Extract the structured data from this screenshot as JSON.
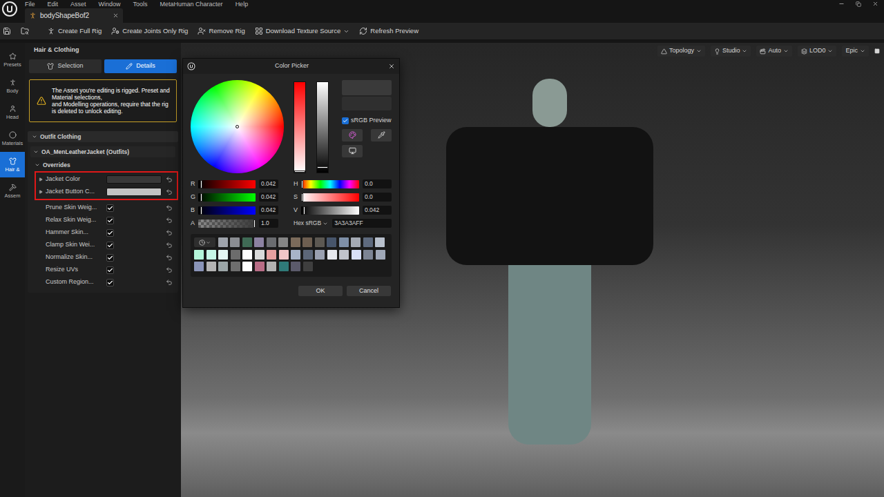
{
  "app": {
    "menu": [
      "File",
      "Edit",
      "Asset",
      "Window",
      "Tools",
      "MetaHuman Character",
      "Help"
    ],
    "document_tab": "bodyShapeBof2"
  },
  "toolbar": [
    {
      "label": "Create Full Rig",
      "dropdown": false
    },
    {
      "label": "Create Joints Only Rig",
      "dropdown": false
    },
    {
      "label": "Remove Rig",
      "dropdown": false
    },
    {
      "label": "Download Texture Source",
      "dropdown": true
    },
    {
      "label": "Refresh Preview",
      "dropdown": false
    }
  ],
  "sidebar": {
    "items": [
      {
        "label": "Presets",
        "selected": false
      },
      {
        "label": "Body",
        "selected": false
      },
      {
        "label": "Head",
        "selected": false
      },
      {
        "label": "Materials",
        "selected": false
      },
      {
        "label": "Hair &",
        "selected": true
      },
      {
        "label": "Assem",
        "selected": false
      }
    ]
  },
  "panel": {
    "title": "Hair & Clothing",
    "tabs": [
      {
        "label": "Selection",
        "selected": false
      },
      {
        "label": "Details",
        "selected": true
      }
    ],
    "warning": "The Asset you're editing is rigged. Preset and Material selections,\nand Modelling operations, require that the rig is deleted to unlock editing.",
    "section": {
      "title": "Outfit Clothing",
      "expanded": true
    },
    "asset": {
      "title": "OA_MenLeatherJacket (Outfits)",
      "expanded": true
    },
    "group": {
      "title": "Overrides",
      "expanded": true
    },
    "properties": [
      {
        "label": "Jacket Color",
        "kind": "color",
        "color": "#383838",
        "highlighted": true
      },
      {
        "label": "Jacket Button C...",
        "kind": "color",
        "color": "#c2c2c2",
        "highlighted": true
      },
      {
        "label": "Prune Skin Weig...",
        "kind": "checkbox",
        "checked": true,
        "highlighted": false
      },
      {
        "label": "Relax Skin Weig...",
        "kind": "checkbox",
        "checked": true,
        "highlighted": false
      },
      {
        "label": "Hammer Skin...",
        "kind": "checkbox",
        "checked": true,
        "highlighted": false
      },
      {
        "label": "Clamp Skin Wei...",
        "kind": "checkbox",
        "checked": true,
        "highlighted": false
      },
      {
        "label": "Normalize Skin...",
        "kind": "checkbox",
        "checked": true,
        "highlighted": false
      },
      {
        "label": "Resize UVs",
        "kind": "checkbox",
        "checked": true,
        "highlighted": false
      },
      {
        "label": "Custom Region...",
        "kind": "checkbox",
        "checked": true,
        "highlighted": false
      }
    ]
  },
  "viewport": {
    "buttons": [
      {
        "label": "Topology"
      },
      {
        "label": "Studio"
      },
      {
        "label": "Auto"
      },
      {
        "label": "LOD0"
      },
      {
        "label": "Epic"
      }
    ]
  },
  "color_picker": {
    "title": "Color Picker",
    "new_color": "#3a3a3a",
    "old_color": "#2f2f2f",
    "saturation_bar": {
      "level": 0.0
    },
    "value_bar": {
      "level": 0.042
    },
    "srgb_preview": {
      "label": "sRGB Preview",
      "checked": true
    },
    "sliders_left": [
      {
        "label": "R",
        "kind": "channel",
        "color": "#ff0000",
        "level": 0.042,
        "value": "0.042"
      },
      {
        "label": "G",
        "kind": "channel",
        "color": "#00ff00",
        "level": 0.042,
        "value": "0.042"
      },
      {
        "label": "B",
        "kind": "channel",
        "color": "#0000ff",
        "level": 0.042,
        "value": "0.042"
      },
      {
        "label": "A",
        "kind": "alpha",
        "level": 1.0,
        "value": "1.0"
      }
    ],
    "sliders_right": [
      {
        "label": "H",
        "kind": "hue",
        "level": 0.0,
        "value": "0.0"
      },
      {
        "label": "S",
        "kind": "saturation",
        "level": 0.0,
        "value": "0.0"
      },
      {
        "label": "V",
        "kind": "value",
        "level": 0.042,
        "value": "0.042"
      }
    ],
    "hex": {
      "label": "Hex sRGB",
      "value": "3A3A3AFF"
    },
    "palette": [
      "#9ea3ab",
      "#8a8d92",
      "#3f6a55",
      "#8c82a2",
      "#6a6c70",
      "#858585",
      "#7b6b5b",
      "#6d5e50",
      "#5c5852",
      "#47556b",
      "#7e8fa7",
      "#a4aab4",
      "#5e6a7e",
      "#b8c0cc",
      "#b3f5d9",
      "#c6f7e6",
      "#e4f6f2",
      "#6c6c6c",
      "#ffffff",
      "#d9d9d9",
      "#e8a0a0",
      "#f2c6c6",
      "#a8b4c8",
      "#5c6678",
      "#9aa0b0",
      "#e6e8ee",
      "#c0c4cc",
      "#d8e0f8",
      "#7c8494",
      "#a0a8b8",
      "#8a94b8",
      "#b4b4b4",
      "#9ca6a8",
      "#6e6e6e",
      "#ffffff",
      "#b86d86",
      "#b2b2b2",
      "#2f7a78",
      "#5b5a6b",
      "#3e3e3e"
    ],
    "buttons": [
      {
        "label": "OK"
      },
      {
        "label": "Cancel"
      }
    ]
  }
}
